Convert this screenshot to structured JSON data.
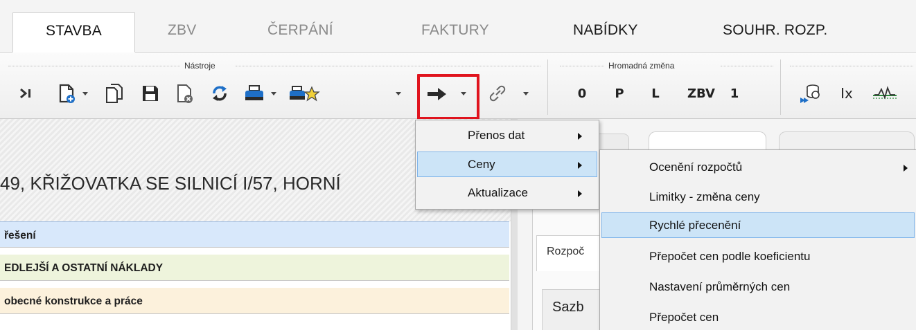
{
  "tabs": [
    {
      "label": "STAVBA",
      "active": true
    },
    {
      "label": "ZBV"
    },
    {
      "label": "ČERPÁNÍ"
    },
    {
      "label": "FAKTURY"
    },
    {
      "label": "NABÍDKY"
    },
    {
      "label": "SOUHR. ROZP."
    }
  ],
  "toolbar": {
    "groups": [
      {
        "label": "Nástroje"
      },
      {
        "label": "Hromadná změna"
      }
    ],
    "bulk_buttons": [
      "0",
      "P",
      "L",
      "ZBV",
      "1"
    ],
    "ix_label": "Ix",
    "icons": [
      "last-record-icon",
      "new-document-icon",
      "copy-icon",
      "save-icon",
      "delete-document-icon",
      "refresh-icon",
      "print-icon",
      "print-favorite-icon",
      "transfer-arrow-icon",
      "link-icon",
      "price-coins-icon",
      "ix-icon",
      "chart-icon"
    ],
    "highlight_color": "#e0141e"
  },
  "left_panel": {
    "title": "49, KŘIŽOVATKA SE SILNICÍ I/57, HORNÍ",
    "rows": [
      {
        "text": "řešení",
        "color": "#d8e8fb"
      },
      {
        "text": "EDLEJŠÍ A OSTATNÍ NÁKLADY",
        "color": "#eef4dc"
      },
      {
        "text": "obecné konstrukce a práce",
        "color": "#fcf1dc"
      }
    ]
  },
  "right_panel": {
    "subtab": "Rozpoč",
    "box": "Sazb"
  },
  "menu_main": [
    {
      "label": "Přenos dat",
      "submenu": true
    },
    {
      "label": "Ceny",
      "submenu": true,
      "selected": true
    },
    {
      "label": "Aktualizace",
      "submenu": true
    }
  ],
  "menu_ceny": [
    {
      "label": "Ocenění rozpočtů",
      "submenu": true
    },
    {
      "label": "Limitky - změna ceny"
    },
    {
      "label": "Rychlé přecenění",
      "selected": true
    },
    {
      "label": "Přepočet cen podle koeficientu"
    },
    {
      "label": "Nastavení průměrných cen"
    },
    {
      "label": "Přepočet cen"
    }
  ],
  "colors": {
    "selection": "#cce4f7",
    "selection_border": "#7eb4ea",
    "accent_blue": "#1e6fc7"
  }
}
